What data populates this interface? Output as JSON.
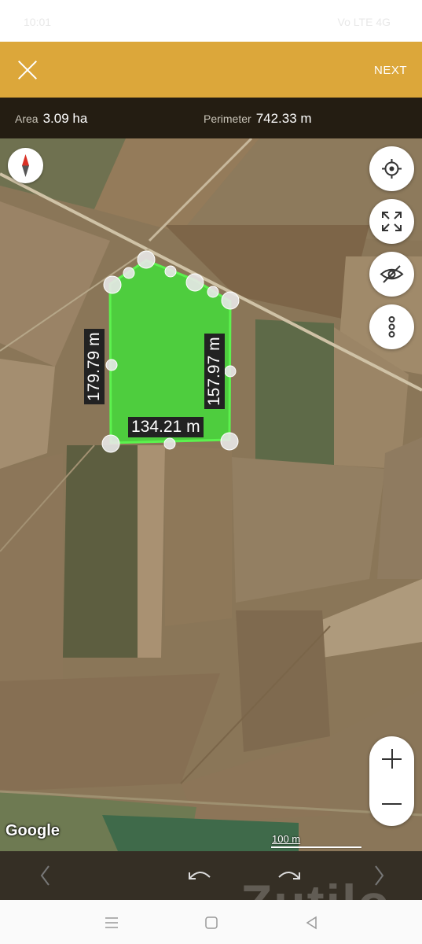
{
  "status_bar": {
    "time": "10:01",
    "right": "Vo LTE 4G"
  },
  "top_bar": {
    "next_label": "NEXT",
    "accent": "#dca73a"
  },
  "measure": {
    "area_label": "Area",
    "area_value": "3.09 ha",
    "perimeter_label": "Perimeter",
    "perimeter_value": "742.33 m"
  },
  "dimensions": {
    "left": "179.79 m",
    "right": "157.97 m",
    "bottom": "134.21 m"
  },
  "map": {
    "attribution": "Google",
    "scale_label": "100 m",
    "polygon_fill": "#45d93a"
  },
  "icons": {
    "close": "close-icon",
    "compass": "compass-icon",
    "locate": "crosshair-icon",
    "fullscreen": "expand-icon",
    "visibility": "eye-off-icon",
    "more": "more-vertical-icon",
    "zoom_in": "plus-icon",
    "zoom_out": "minus-icon",
    "back": "chevron-left-icon",
    "undo": "undo-icon",
    "redo": "redo-icon",
    "forward": "chevron-right-icon"
  },
  "watermark": "Zutilo"
}
